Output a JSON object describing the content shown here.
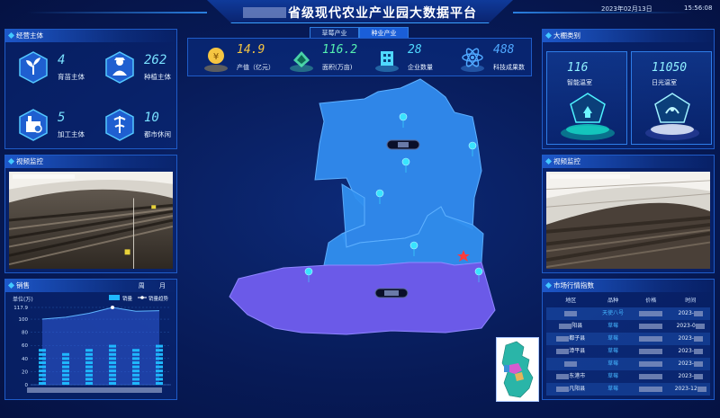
{
  "header": {
    "title": "省级现代农业产业园大数据平台",
    "date": "2023年02月13日",
    "time": "15:56:08"
  },
  "left": {
    "entities_title": "经营主体",
    "entities": [
      {
        "value": "4",
        "label": "育苗主体",
        "icon": "sprout-icon"
      },
      {
        "value": "262",
        "label": "种植主体",
        "icon": "farmer-icon"
      },
      {
        "value": "5",
        "label": "加工主体",
        "icon": "factory-icon"
      },
      {
        "value": "10",
        "label": "都市休闲",
        "icon": "leisure-icon"
      }
    ],
    "video_title": "视频监控",
    "sales": {
      "title": "销售",
      "period_week": "周",
      "period_month": "月",
      "unit": "单位(万)",
      "legend_bar": "销量",
      "legend_line": "销量趋势"
    }
  },
  "center": {
    "tabs": [
      {
        "label": "草莓产业",
        "active": false
      },
      {
        "label": "种业产业",
        "active": true
      }
    ],
    "stats": [
      {
        "value": "14.9",
        "label": "产值（亿元）",
        "color": "#f5c542",
        "icon": "yuan-icon"
      },
      {
        "value": "116.2",
        "label": "面积(万亩)",
        "color": "#55f0b0",
        "icon": "area-icon"
      },
      {
        "value": "28",
        "label": "企业数量",
        "color": "#4fd8ff",
        "icon": "enterprise-icon"
      },
      {
        "value": "488",
        "label": "科技成果数",
        "color": "#4fa8ff",
        "icon": "atom-icon"
      }
    ]
  },
  "right": {
    "greenhouse_title": "大棚类别",
    "greenhouses": [
      {
        "value": "116",
        "label": "智能温室"
      },
      {
        "value": "11050",
        "label": "日光温室"
      }
    ],
    "video_title": "视频监控",
    "market": {
      "title": "市场行情指数",
      "headers": [
        "地区",
        "品种",
        "价格",
        "时间"
      ],
      "rows": [
        {
          "region": "",
          "product": "天使八号",
          "price": "",
          "time": "2023-"
        },
        {
          "region": "阳县",
          "product": "草莓",
          "price": "",
          "time": "2023-0"
        },
        {
          "region": "都子县",
          "product": "草莓",
          "price": "",
          "time": "2023-"
        },
        {
          "region": "漳平县",
          "product": "草莓",
          "price": "",
          "time": "2023-"
        },
        {
          "region": "",
          "product": "草莓",
          "price": "",
          "time": "2023-"
        },
        {
          "region": "东港市",
          "product": "草莓",
          "price": "",
          "time": "2023-"
        },
        {
          "region": "凡阳县",
          "product": "草莓",
          "price": "",
          "time": "2023-12"
        }
      ]
    }
  },
  "chart_data": {
    "type": "bar",
    "title": "销售",
    "ylabel": "单位(万)",
    "ylim": [
      0,
      117.9
    ],
    "yticks": [
      "0",
      "20",
      "40",
      "60",
      "80",
      "100",
      "117.9"
    ],
    "categories": [
      "",
      "",
      "",
      "",
      "",
      ""
    ],
    "series": [
      {
        "name": "销量",
        "type": "bar",
        "values": [
          60,
          52,
          58,
          62,
          60,
          63
        ]
      },
      {
        "name": "销量趋势",
        "type": "line",
        "values": [
          100,
          103,
          109,
          117.9,
          112,
          113
        ]
      }
    ]
  }
}
